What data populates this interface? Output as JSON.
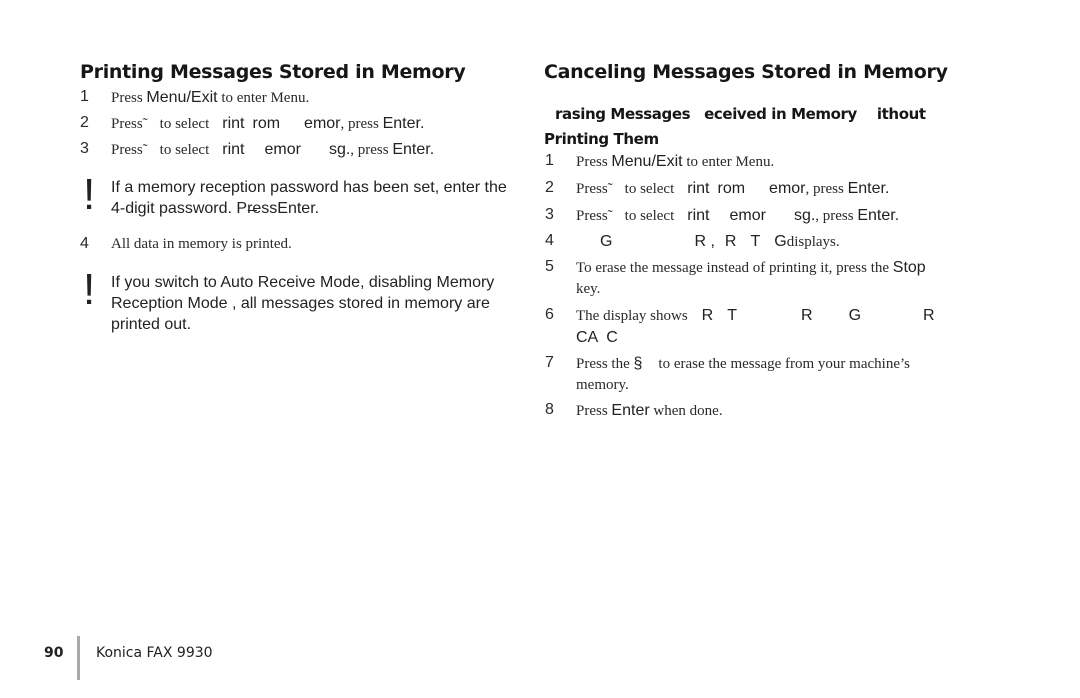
{
  "left": {
    "heading": "Printing Messages Stored in Memory",
    "steps": [
      {
        "num": "1",
        "pre": "Press ",
        "key": "Menu/Exit",
        "post": " to enter Menu."
      },
      {
        "num": "2",
        "pre": "Press˜",
        "mid": "to select",
        "display": [
          "rint",
          "rom",
          "emor"
        ],
        "post": ", press ",
        "key": "Enter."
      },
      {
        "num": "3",
        "pre": "Press˜",
        "mid": "to select",
        "display": [
          "rint",
          "emor",
          "sg."
        ],
        "post": ", press ",
        "key": "Enter."
      }
    ],
    "note1": {
      "icon": "!",
      "line1": "If a memory reception password has been set, enter the",
      "line2": "4-digit password. Pr̶essEnter."
    },
    "step4": {
      "num": "4",
      "text": "All data in memory is printed."
    },
    "note2": {
      "icon": "!",
      "line1": "If you switch to Auto Receive Mode, disabling Memory",
      "line2": "Reception Mode , all messages stored in memory are",
      "line3": "printed out."
    }
  },
  "right": {
    "heading": "Canceling Messages Stored in Memory",
    "subheading_line1": [
      "rasing Messages",
      "eceived in Memory",
      "ithout"
    ],
    "subheading_line2": "Printing Them",
    "steps": [
      {
        "num": "1",
        "pre": "Press ",
        "key": "Menu/Exit",
        "post": " to enter Menu."
      },
      {
        "num": "2",
        "pre": "Press˜",
        "mid": "to select",
        "display": [
          "rint",
          "rom",
          "emor"
        ],
        "post": ", press ",
        "key": "Enter."
      },
      {
        "num": "3",
        "pre": "Press˜",
        "mid": "to select",
        "display": [
          "rint",
          "emor",
          "sg."
        ],
        "post": ", press ",
        "key": "Enter."
      },
      {
        "num": "4",
        "display": [
          "G",
          "R ,",
          "R",
          "T",
          "G"
        ],
        "post": "displays."
      },
      {
        "num": "5",
        "line1_pre": "To erase the message instead of printing it, press the ",
        "line1_key": "Stop",
        "line2": "key."
      },
      {
        "num": "6",
        "pre": "The display shows",
        "display": [
          "R",
          "T",
          "R",
          "G",
          "R"
        ],
        "line2": "CA  C"
      },
      {
        "num": "7",
        "pre": "Press the ",
        "key": "§",
        "post": "to erase the message from your machine’s",
        "line2": "memory."
      },
      {
        "num": "8",
        "pre": "Press ",
        "key": "Enter",
        "post": " when done."
      }
    ]
  },
  "footer": {
    "page_number": "90",
    "title": "Konica FAX 9930"
  }
}
